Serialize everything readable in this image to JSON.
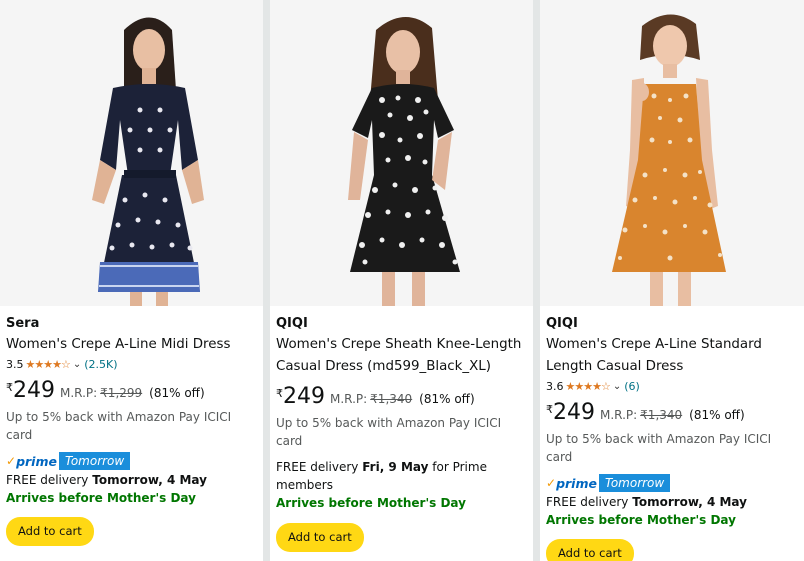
{
  "products": [
    {
      "brand": "Sera",
      "title_line1": "Women's Crepe A-Line Midi Dress",
      "title_line2": "",
      "rating": "3.5",
      "stars": "★★★★☆",
      "review_count": "(2.5K)",
      "currency": "₹",
      "price": "249",
      "mrp_label": "M.R.P:",
      "mrp_value": "₹1,299",
      "discount": "(81% off)",
      "cashback": "Up to 5% back with Amazon Pay ICICI card",
      "prime_text": "prime",
      "prime_badge": "Tomorrow",
      "delivery_prefix": "FREE delivery ",
      "delivery_date": "Tomorrow, 4 May",
      "delivery_suffix": "",
      "mothers_day": "Arrives before Mother's Day",
      "button_label": "Add to cart"
    },
    {
      "brand": "QIQI",
      "title_line1": "Women's Crepe Sheath Knee-Length",
      "title_line2": "Casual Dress (md599_Black_XL)",
      "currency": "₹",
      "price": "249",
      "mrp_label": "M.R.P:",
      "mrp_value": "₹1,340",
      "discount": "(81% off)",
      "cashback": "Up to 5% back with Amazon Pay ICICI card",
      "delivery_prefix": "FREE delivery ",
      "delivery_date": "Fri, 9 May",
      "delivery_suffix": " for Prime members",
      "mothers_day": "Arrives before Mother's Day",
      "button_label": "Add to cart"
    },
    {
      "brand": "QIQI",
      "title_line1": "Women's Crepe A-Line Standard",
      "title_line2": "Length Casual Dress",
      "rating": "3.6",
      "stars": "★★★★☆",
      "review_count": "(6)",
      "currency": "₹",
      "price": "249",
      "mrp_label": "M.R.P:",
      "mrp_value": "₹1,340",
      "discount": "(81% off)",
      "cashback": "Up to 5% back with Amazon Pay ICICI card",
      "prime_text": "prime",
      "prime_badge": "Tomorrow",
      "delivery_prefix": "FREE delivery ",
      "delivery_date": "Tomorrow, 4 May",
      "delivery_suffix": "",
      "mothers_day": "Arrives before Mother's Day",
      "button_label": "Add to cart"
    }
  ],
  "colors": {
    "star": "#de7921",
    "link": "#007185",
    "prime": "#0066c0",
    "prime_badge": "#1a8edb",
    "mothers_day": "#007600",
    "button": "#ffd814"
  }
}
